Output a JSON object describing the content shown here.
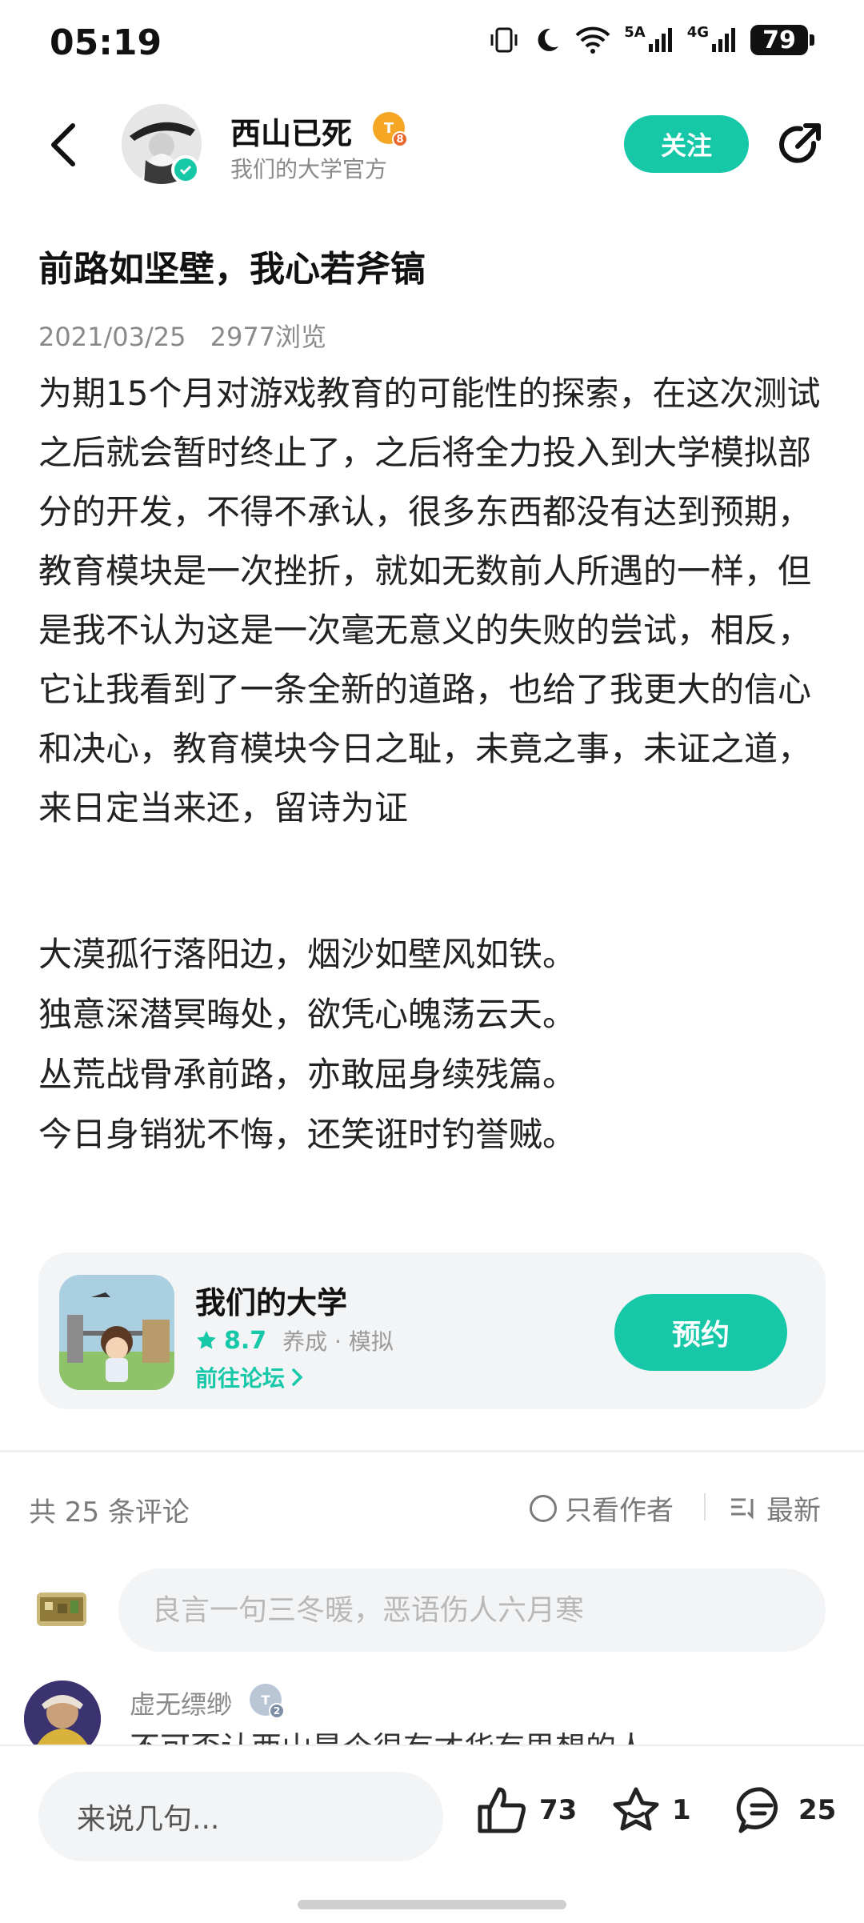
{
  "status_bar": {
    "time": "05:19",
    "signal1_label": "5A",
    "signal2_label": "4G",
    "battery": "79"
  },
  "header": {
    "author_name": "西山已死",
    "author_level": "T",
    "author_level_num": "8",
    "author_subtitle": "我们的大学官方",
    "follow_label": "关注"
  },
  "post": {
    "title": "前路如坚壁，我心若斧镐",
    "date": "2021/03/25",
    "views": "2977浏览",
    "body": "为期15个月对游戏教育的可能性的探索，在这次测试之后就会暂时终止了，之后将全力投入到大学模拟部分的开发，不得不承认，很多东西都没有达到预期，教育模块是一次挫折，就如无数前人所遇的一样，但是我不认为这是一次毫无意义的失败的尝试，相反，它让我看到了一条全新的道路，也给了我更大的信心和决心，教育模块今日之耻，未竟之事，未证之道，来日定当来还，留诗为证",
    "poem": [
      "大漠孤行落阳边，烟沙如壁风如铁。",
      "独意深潜冥晦处，欲凭心魄荡云天。",
      "丛荒战骨承前路，亦敢屈身续残篇。",
      "今日身销犹不悔，还笑诳时钓誉贼。"
    ]
  },
  "game_card": {
    "name": "我们的大学",
    "rating": "8.7",
    "tags": "养成 · 模拟",
    "forum_link": "前往论坛",
    "reserve_label": "预约"
  },
  "comments": {
    "count_label": "共 25 条评论",
    "only_author": "只看作者",
    "sort_label": "最新",
    "input_placeholder": "良言一句三冬暖，恶语伤人六月寒",
    "first": {
      "name": "虚无缥缈",
      "level": "T",
      "level_num": "2",
      "text_partial": "不可否认西山是个很有才华有思想的人"
    }
  },
  "bottom_bar": {
    "say_placeholder": "来说几句...",
    "likes": "73",
    "favorites": "1",
    "comments": "25"
  },
  "colors": {
    "accent": "#16c7a8",
    "text_primary": "#1f1f1f",
    "text_secondary": "#8a8a8a",
    "card_bg": "#f2f4f6"
  }
}
